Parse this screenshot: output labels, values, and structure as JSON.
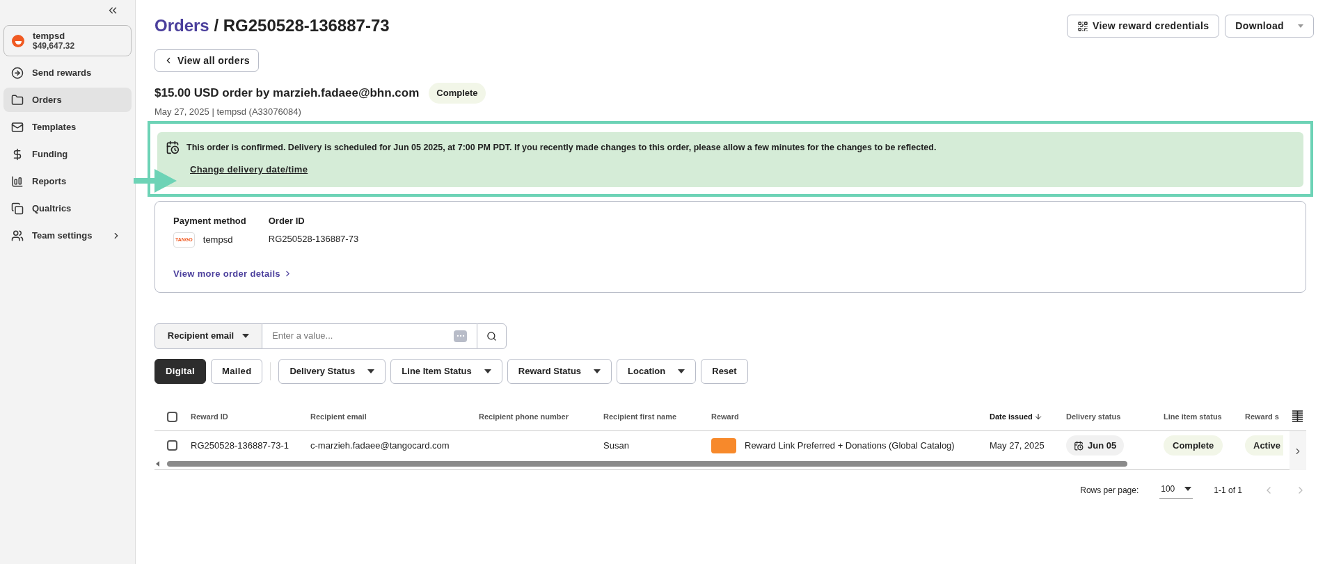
{
  "sidebar": {
    "account": {
      "name": "tempsd",
      "balance": "$49,647.32"
    },
    "items": [
      {
        "label": "Send rewards",
        "selected": false
      },
      {
        "label": "Orders",
        "selected": true
      },
      {
        "label": "Templates",
        "selected": false
      },
      {
        "label": "Funding",
        "selected": false
      },
      {
        "label": "Reports",
        "selected": false
      },
      {
        "label": "Qualtrics",
        "selected": false
      },
      {
        "label": "Team settings",
        "selected": false,
        "has_submenu": true
      }
    ]
  },
  "breadcrumb": {
    "parent": "Orders",
    "separator": "/",
    "current": "RG250528-136887-73"
  },
  "header_buttons": [
    {
      "label": "View reward credentials",
      "kind": "qr"
    },
    {
      "label": "Download",
      "kind": "dropdown"
    }
  ],
  "back_button": "View all orders",
  "order": {
    "title": "$15.00 USD order by marzieh.fadaee@bhn.com",
    "status": "Complete",
    "meta": "May 27, 2025 | tempsd (A33076084)"
  },
  "notice": {
    "message": "This order is confirmed. Delivery is scheduled for Jun 05 2025, at 7:00 PM PDT. If you recently made changes to this order, please allow a few minutes for the changes to be reflected.",
    "link": "Change delivery date/time"
  },
  "details": {
    "payment_label": "Payment method",
    "payment_logo": "TANGO",
    "payment_value": "tempsd",
    "order_id_label": "Order ID",
    "order_id": "RG250528-136887-73",
    "more_link": "View more order details"
  },
  "search": {
    "field": "Recipient email",
    "placeholder": "Enter a value..."
  },
  "filters": [
    {
      "label": "Digital",
      "kind": "toggle",
      "selected": true
    },
    {
      "label": "Mailed",
      "kind": "toggle",
      "selected": false
    },
    {
      "label": "Delivery Status",
      "kind": "dropdown"
    },
    {
      "label": "Line Item Status",
      "kind": "dropdown"
    },
    {
      "label": "Reward Status",
      "kind": "dropdown"
    },
    {
      "label": "Location",
      "kind": "dropdown"
    },
    {
      "label": "Reset",
      "kind": "button"
    }
  ],
  "table": {
    "all_checked": false,
    "columns": [
      {
        "label": "Reward ID",
        "sorted": false
      },
      {
        "label": "Recipient email",
        "sorted": false
      },
      {
        "label": "Recipient phone number",
        "sorted": false
      },
      {
        "label": "Recipient first name",
        "sorted": false
      },
      {
        "label": "Reward",
        "sorted": false
      },
      {
        "label": "Date issued",
        "sorted": true
      },
      {
        "label": "Delivery status",
        "sorted": false
      },
      {
        "label": "Line item status",
        "sorted": false
      },
      {
        "label": "Reward s",
        "sorted": false
      }
    ],
    "rows": [
      {
        "checked": false,
        "reward_id": "RG250528-136887-73-1",
        "email": "c-marzieh.fadaee@tangocard.com",
        "first_name": "Susan",
        "reward": "Reward Link Preferred + Donations (Global Catalog)",
        "date": "May 27, 2025",
        "delivery": "Jun 05",
        "line_status": "Complete",
        "reward_status": "Active"
      }
    ]
  },
  "pagination": {
    "rows_label": "Rows per page:",
    "rows_value": "100",
    "range": "1-1 of 1"
  }
}
